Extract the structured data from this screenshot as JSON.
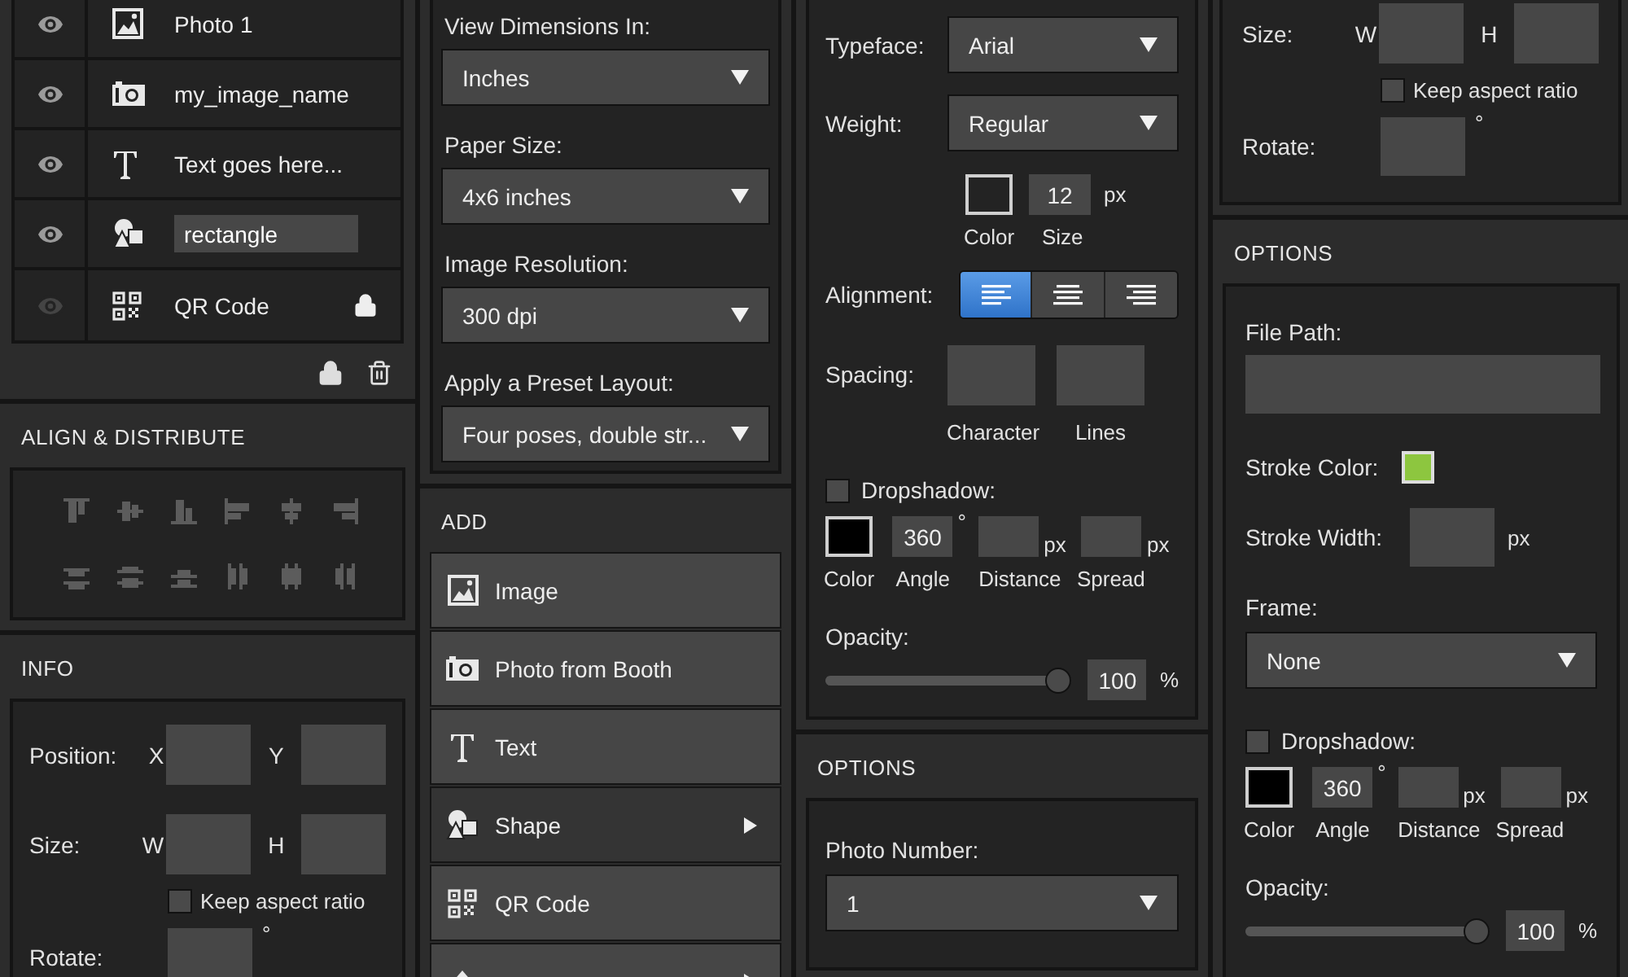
{
  "layers": {
    "items": [
      {
        "kind": "image",
        "name": "Photo 1",
        "visible": true,
        "locked": false,
        "editing": false
      },
      {
        "kind": "camera",
        "name": "my_image_name",
        "visible": true,
        "locked": false,
        "editing": false
      },
      {
        "kind": "text",
        "name": "Text goes here...",
        "visible": true,
        "locked": false,
        "editing": false
      },
      {
        "kind": "shape",
        "name": "rectangle",
        "visible": true,
        "locked": false,
        "editing": true
      },
      {
        "kind": "qr",
        "name": "QR Code",
        "visible": false,
        "locked": true,
        "editing": false
      }
    ]
  },
  "align_distribute": {
    "title": "ALIGN & DISTRIBUTE"
  },
  "info": {
    "title": "INFO",
    "position": {
      "label": "Position:",
      "x_label": "X",
      "y_label": "Y"
    },
    "size": {
      "label": "Size:",
      "w_label": "W",
      "h_label": "H"
    },
    "keep_aspect": {
      "label": "Keep aspect ratio",
      "checked": false
    },
    "rotate": {
      "label": "Rotate:",
      "unit": "°"
    }
  },
  "document": {
    "fields": [
      {
        "label": "View Dimensions In:",
        "value": "Inches"
      },
      {
        "label": "Paper Size:",
        "value": "4x6 inches"
      },
      {
        "label": "Image Resolution:",
        "value": "300 dpi"
      },
      {
        "label": "Apply a Preset Layout:",
        "value": "Four poses, double str..."
      }
    ]
  },
  "add": {
    "title": "ADD",
    "items": [
      {
        "kind": "image",
        "label": "Image",
        "submenu": false,
        "selected": false
      },
      {
        "kind": "camera",
        "label": "Photo from Booth",
        "submenu": false,
        "selected": false
      },
      {
        "kind": "text",
        "label": "Text",
        "submenu": false,
        "selected": false
      },
      {
        "kind": "shape",
        "label": "Shape",
        "submenu": true,
        "selected": true
      },
      {
        "kind": "qr",
        "label": "QR Code",
        "submenu": false,
        "selected": false
      },
      {
        "kind": "fill",
        "submenu": true,
        "selected": false
      }
    ]
  },
  "text_style": {
    "typeface": {
      "label": "Typeface:",
      "value": "Arial"
    },
    "weight": {
      "label": "Weight:",
      "value": "Regular"
    },
    "color": {
      "label": "Color",
      "color": "#232323"
    },
    "size": {
      "label": "Size",
      "value": "12",
      "unit": "px"
    },
    "alignment": {
      "label": "Alignment:",
      "options": [
        {
          "kind": "left",
          "selected": true
        },
        {
          "kind": "center",
          "selected": false
        },
        {
          "kind": "right",
          "selected": false
        }
      ]
    },
    "spacing": {
      "label": "Spacing:",
      "character_label": "Character",
      "lines_label": "Lines"
    },
    "dropshadow": {
      "label": "Dropshadow:",
      "checked": false,
      "color": "#000000",
      "color_label": "Color",
      "angle": "360",
      "angle_unit": "°",
      "angle_label": "Angle",
      "distance_unit": "px",
      "distance_label": "Distance",
      "spread_unit": "px",
      "spread_label": "Spread"
    },
    "opacity": {
      "label": "Opacity:",
      "level": 1,
      "value": "100",
      "unit": "%"
    }
  },
  "options": {
    "title": "OPTIONS",
    "photo_number": {
      "label": "Photo Number:",
      "value": "1"
    }
  },
  "shape_info": {
    "size": {
      "label": "Size:",
      "w_label": "W",
      "h_label": "H"
    },
    "keep_aspect": {
      "label": "Keep aspect ratio",
      "checked": false
    },
    "rotate": {
      "label": "Rotate:",
      "unit": "°"
    }
  },
  "shape_options": {
    "title": "OPTIONS",
    "file_path": {
      "label": "File Path:"
    },
    "stroke_color": {
      "label": "Stroke Color:",
      "color": "#8dc63f"
    },
    "stroke_width": {
      "label": "Stroke Width:",
      "unit": "px"
    },
    "frame": {
      "label": "Frame:",
      "value": "None"
    },
    "dropshadow": {
      "label": "Dropshadow:",
      "checked": false,
      "color": "#000000",
      "color_label": "Color",
      "angle": "360",
      "angle_unit": "°",
      "angle_label": "Angle",
      "distance_unit": "px",
      "distance_label": "Distance",
      "spread_unit": "px",
      "spread_label": "Spread"
    },
    "opacity": {
      "label": "Opacity:",
      "level": 1,
      "value": "100",
      "unit": "%"
    }
  }
}
